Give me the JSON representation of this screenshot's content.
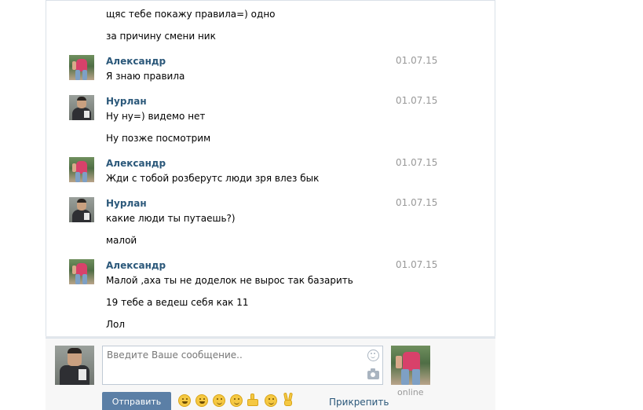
{
  "messages": [
    {
      "text": "щяс тебе покажу правила=) одно"
    },
    {
      "text": "за причину смени ник"
    },
    {
      "author": "Александр",
      "date": "01.07.15",
      "text": "Я знаю правила"
    },
    {
      "author": "Нурлан",
      "date": "01.07.15",
      "text": "Ну ну=) видемо нет"
    },
    {
      "text": "Ну позже посмотрим"
    },
    {
      "author": "Александр",
      "date": "01.07.15",
      "text": "Жди с тобой розберутс люди зря влез бык"
    },
    {
      "author": "Нурлан",
      "date": "01.07.15",
      "text": "какие люди ты путаешь?)"
    },
    {
      "text": "малой"
    },
    {
      "author": "Александр",
      "date": "01.07.15",
      "text": "Малой ,аха ты не доделок не вырос так базарить"
    },
    {
      "text": "19 тебе а ведеш себя как 11"
    },
    {
      "text": "Лол"
    }
  ],
  "composer": {
    "placeholder": "Введите Ваше сообщение..",
    "value": "",
    "send_label": "Отправить",
    "attach_label": "Прикрепить",
    "status": "online",
    "emojis": [
      "laughing",
      "grinning",
      "smirk",
      "smile",
      "thumbs-up",
      "persevering",
      "victory-hand"
    ]
  },
  "colors": {
    "author": "#2b587a",
    "date": "#999999",
    "send_button": "#5b7fa6"
  }
}
